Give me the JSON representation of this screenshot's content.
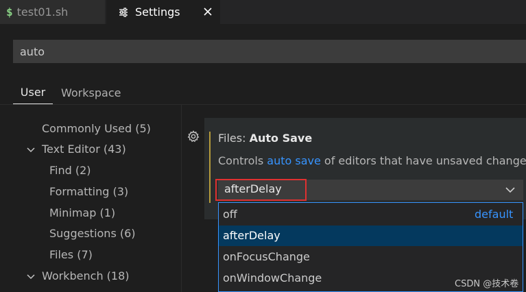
{
  "tabs": [
    {
      "label": "test01.sh",
      "active": false
    },
    {
      "label": "Settings",
      "active": true
    }
  ],
  "search": {
    "value": "auto"
  },
  "scope_tabs": [
    {
      "label": "User",
      "active": true
    },
    {
      "label": "Workspace",
      "active": false
    }
  ],
  "toc": [
    {
      "label": "Commonly Used (5)"
    },
    {
      "label": "Text Editor (43)",
      "expanded": true
    },
    {
      "label": "Find (2)"
    },
    {
      "label": "Formatting (3)"
    },
    {
      "label": "Minimap (1)"
    },
    {
      "label": "Suggestions (6)"
    },
    {
      "label": "Files (7)"
    },
    {
      "label": "Workbench (18)",
      "expanded": true
    }
  ],
  "setting": {
    "category": "Files: ",
    "name": "Auto Save",
    "desc_before": "Controls ",
    "desc_link": "auto save",
    "desc_after": " of editors that have unsaved changes",
    "value": "afterDelay",
    "options": [
      {
        "label": "off",
        "tag": "default"
      },
      {
        "label": "afterDelay",
        "selected": true
      },
      {
        "label": "onFocusChange"
      },
      {
        "label": "onWindowChange"
      }
    ]
  },
  "watermark": "CSDN @技术卷",
  "colors": {
    "accent": "#3794ff",
    "selected_option": "#04395e",
    "highlight_border": "#e03030",
    "shell_icon": "#89d185"
  }
}
